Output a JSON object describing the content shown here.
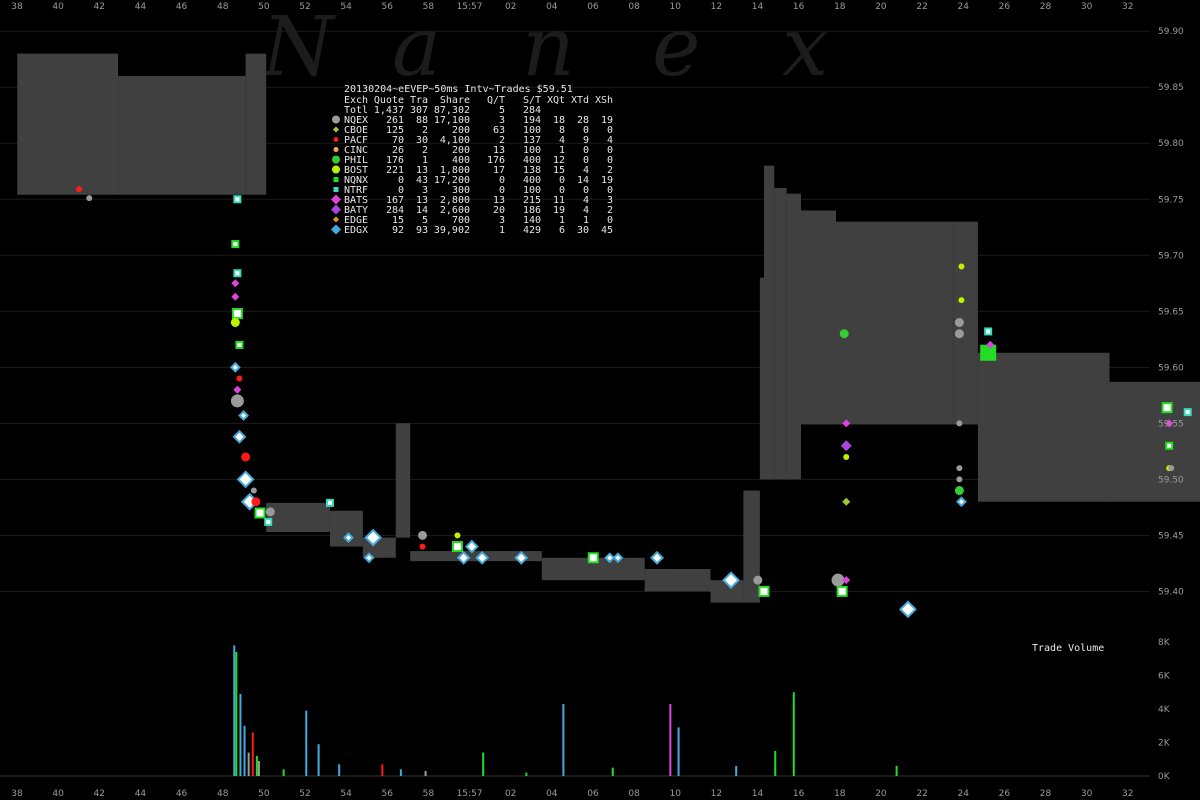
{
  "watermark": [
    "N",
    "a",
    "n",
    "e",
    "x"
  ],
  "colors": {
    "background": "#000000",
    "nbbo_band": "#404040",
    "gridline": "#1b1b1b",
    "cursor": "#666666",
    "NQEX": "#9a9a9a",
    "CBOE": "#9acd32",
    "PACF": "#ff1a1a",
    "CINC": "#ffa64d",
    "PHIL": "#33cc33",
    "BOST": "#bff000",
    "NQNX": "#22dd22",
    "NTRF": "#33ddbb",
    "BATS": "#dd44dd",
    "BATY": "#aa44dd",
    "EDGE": "#dd9911",
    "EDGX": "#44aadd"
  },
  "chart_data": {
    "type": "scatter",
    "title": "20130204~eEVEP~50ms Intv~Trades $59.51",
    "x_ticks_top": [
      "38",
      "40",
      "42",
      "44",
      "46",
      "48",
      "50",
      "52",
      "54",
      "56",
      "58",
      "15:57",
      "02",
      "04",
      "06",
      "08",
      "10",
      "12",
      "14",
      "16",
      "18",
      "20",
      "22",
      "24",
      "26",
      "28",
      "30",
      "32"
    ],
    "x_ticks_bottom": [
      "38",
      "40",
      "42",
      "44",
      "46",
      "48",
      "50",
      "52",
      "54",
      "56",
      "58",
      "15:57",
      "02",
      "04",
      "06",
      "08",
      "10",
      "12",
      "14",
      "16",
      "18",
      "20",
      "22",
      "24",
      "26",
      "28",
      "30",
      "32"
    ],
    "xlim": [
      37,
      133
    ],
    "cursor_x": 96,
    "ylim": [
      59.37,
      59.91
    ],
    "y_ticks": [
      "59.90",
      "59.85",
      "59.80",
      "59.75",
      "59.70",
      "59.65",
      "59.60",
      "59.55",
      "59.50",
      "59.45",
      "59.40"
    ],
    "volume_label": "Trade Volume",
    "volume_ylim": [
      0,
      8000
    ],
    "volume_ticks": [
      "8K",
      "6K",
      "4K",
      "2K",
      "0K"
    ],
    "legend": {
      "columns": [
        "Exch",
        "Quote",
        "Tra",
        "Share",
        "Q/T",
        "S/T",
        "XQt",
        "XTd",
        "XSh"
      ],
      "total_row": [
        "Totl",
        "1,437",
        "307",
        "87,302",
        "5",
        "284",
        "",
        "",
        ""
      ],
      "rows": [
        {
          "exch": "NQEX",
          "quote": "261",
          "tra": "88",
          "share": "17,100",
          "qt": "3",
          "st": "194",
          "xqt": "18",
          "xtd": "28",
          "xsh": "19",
          "marker": "circle"
        },
        {
          "exch": "CBOE",
          "quote": "125",
          "tra": "2",
          "share": "200",
          "qt": "63",
          "st": "100",
          "xqt": "8",
          "xtd": "0",
          "xsh": "0",
          "marker": "diamond"
        },
        {
          "exch": "PACF",
          "quote": "70",
          "tra": "30",
          "share": "4,100",
          "qt": "2",
          "st": "137",
          "xqt": "4",
          "xtd": "9",
          "xsh": "4",
          "marker": "circle"
        },
        {
          "exch": "CINC",
          "quote": "26",
          "tra": "2",
          "share": "200",
          "qt": "13",
          "st": "100",
          "xqt": "1",
          "xtd": "0",
          "xsh": "0",
          "marker": "circle"
        },
        {
          "exch": "PHIL",
          "quote": "176",
          "tra": "1",
          "share": "400",
          "qt": "176",
          "st": "400",
          "xqt": "12",
          "xtd": "0",
          "xsh": "0",
          "marker": "circle"
        },
        {
          "exch": "BOST",
          "quote": "221",
          "tra": "13",
          "share": "1,800",
          "qt": "17",
          "st": "138",
          "xqt": "15",
          "xtd": "4",
          "xsh": "2",
          "marker": "circle"
        },
        {
          "exch": "NQNX",
          "quote": "0",
          "tra": "43",
          "share": "17,200",
          "qt": "0",
          "st": "400",
          "xqt": "0",
          "xtd": "14",
          "xsh": "19",
          "marker": "square"
        },
        {
          "exch": "NTRF",
          "quote": "0",
          "tra": "3",
          "share": "300",
          "qt": "0",
          "st": "100",
          "xqt": "0",
          "xtd": "0",
          "xsh": "0",
          "marker": "square"
        },
        {
          "exch": "BATS",
          "quote": "167",
          "tra": "13",
          "share": "2,800",
          "qt": "13",
          "st": "215",
          "xqt": "11",
          "xtd": "4",
          "xsh": "3",
          "marker": "diamond"
        },
        {
          "exch": "BATY",
          "quote": "284",
          "tra": "14",
          "share": "2,600",
          "qt": "20",
          "st": "186",
          "xqt": "19",
          "xtd": "4",
          "xsh": "2",
          "marker": "diamond"
        },
        {
          "exch": "EDGE",
          "quote": "15",
          "tra": "5",
          "share": "700",
          "qt": "3",
          "st": "140",
          "xqt": "1",
          "xtd": "1",
          "xsh": "0",
          "marker": "diamond"
        },
        {
          "exch": "EDGX",
          "quote": "92",
          "tra": "93",
          "share": "39,902",
          "qt": "1",
          "st": "429",
          "xqt": "6",
          "xtd": "30",
          "xsh": "45",
          "marker": "diamond"
        }
      ]
    },
    "nbbo_band": [
      {
        "x0": 37.5,
        "x1": 42.4,
        "lo": 59.754,
        "hi": 59.88
      },
      {
        "x0": 42.4,
        "x1": 48.6,
        "lo": 59.754,
        "hi": 59.86
      },
      {
        "x0": 48.6,
        "x1": 49.6,
        "lo": 59.754,
        "hi": 59.88
      },
      {
        "x0": 49.6,
        "x1": 52.7,
        "lo": 59.453,
        "hi": 59.479
      },
      {
        "x0": 52.7,
        "x1": 54.3,
        "lo": 59.44,
        "hi": 59.472
      },
      {
        "x0": 54.3,
        "x1": 55.9,
        "lo": 59.43,
        "hi": 59.448
      },
      {
        "x0": 55.9,
        "x1": 56.6,
        "lo": 59.448,
        "hi": 59.55
      },
      {
        "x0": 56.6,
        "x1": 63.0,
        "lo": 59.427,
        "hi": 59.436
      },
      {
        "x0": 63.0,
        "x1": 68.0,
        "lo": 59.41,
        "hi": 59.43
      },
      {
        "x0": 68.0,
        "x1": 71.2,
        "lo": 59.4,
        "hi": 59.42
      },
      {
        "x0": 71.2,
        "x1": 72.8,
        "lo": 59.39,
        "hi": 59.41
      },
      {
        "x0": 72.8,
        "x1": 73.6,
        "lo": 59.39,
        "hi": 59.49
      },
      {
        "x0": 73.6,
        "x1": 73.8,
        "lo": 59.5,
        "hi": 59.68
      },
      {
        "x0": 73.8,
        "x1": 74.3,
        "lo": 59.5,
        "hi": 59.78
      },
      {
        "x0": 74.3,
        "x1": 74.9,
        "lo": 59.5,
        "hi": 59.76
      },
      {
        "x0": 74.9,
        "x1": 75.6,
        "lo": 59.5,
        "hi": 59.755
      },
      {
        "x0": 75.6,
        "x1": 77.3,
        "lo": 59.549,
        "hi": 59.74
      },
      {
        "x0": 77.3,
        "x1": 83.0,
        "lo": 59.549,
        "hi": 59.73
      },
      {
        "x0": 83.0,
        "x1": 84.2,
        "lo": 59.549,
        "hi": 59.73
      },
      {
        "x0": 84.2,
        "x1": 90.6,
        "lo": 59.48,
        "hi": 59.613
      },
      {
        "x0": 90.6,
        "x1": 96.5,
        "lo": 59.48,
        "hi": 59.587
      },
      {
        "x0": 96.5,
        "x1": 96.7,
        "lo": 59.48,
        "hi": 59.6
      },
      {
        "x0": 96.7,
        "x1": 99.2,
        "lo": 59.48,
        "hi": 59.66
      },
      {
        "x0": 99.2,
        "x1": 100.9,
        "lo": 59.5,
        "hi": 59.66
      },
      {
        "x0": 100.9,
        "x1": 103.0,
        "lo": 59.55,
        "hi": 59.66
      },
      {
        "x0": 103.0,
        "x1": 105.7,
        "lo": 59.56,
        "hi": 59.66
      }
    ],
    "trades": [
      {
        "t": 40.5,
        "p": 59.759,
        "ex": "PACF",
        "sz": "s"
      },
      {
        "t": 41,
        "p": 59.751,
        "ex": "NQEX",
        "sz": "s"
      },
      {
        "t": 48.2,
        "p": 59.75,
        "ex": "NTRF",
        "sz": "s"
      },
      {
        "t": 48.1,
        "p": 59.71,
        "ex": "NQNX",
        "sz": "s"
      },
      {
        "t": 48.2,
        "p": 59.684,
        "ex": "NTRF",
        "sz": "s"
      },
      {
        "t": 48.1,
        "p": 59.675,
        "ex": "BATS",
        "sz": "s"
      },
      {
        "t": 48.1,
        "p": 59.663,
        "ex": "BATS",
        "sz": "s"
      },
      {
        "t": 48.2,
        "p": 59.648,
        "ex": "NQNX",
        "sz": "m"
      },
      {
        "t": 48.1,
        "p": 59.64,
        "ex": "BOST",
        "sz": "m"
      },
      {
        "t": 48.3,
        "p": 59.62,
        "ex": "NQNX",
        "sz": "s"
      },
      {
        "t": 48.1,
        "p": 59.6,
        "ex": "EDGX",
        "sz": "s"
      },
      {
        "t": 48.3,
        "p": 59.59,
        "ex": "PACF",
        "sz": "s"
      },
      {
        "t": 48.2,
        "p": 59.58,
        "ex": "BATS",
        "sz": "s"
      },
      {
        "t": 48.2,
        "p": 59.57,
        "ex": "NQEX",
        "sz": "l"
      },
      {
        "t": 48.5,
        "p": 59.557,
        "ex": "EDGX",
        "sz": "s"
      },
      {
        "t": 48.3,
        "p": 59.538,
        "ex": "EDGX",
        "sz": "m"
      },
      {
        "t": 48.6,
        "p": 59.52,
        "ex": "PACF",
        "sz": "m"
      },
      {
        "t": 48.6,
        "p": 59.5,
        "ex": "EDGX",
        "sz": "l"
      },
      {
        "t": 49.0,
        "p": 59.49,
        "ex": "NQEX",
        "sz": "s"
      },
      {
        "t": 48.8,
        "p": 59.48,
        "ex": "EDGX",
        "sz": "l"
      },
      {
        "t": 49.1,
        "p": 59.48,
        "ex": "PACF",
        "sz": "m"
      },
      {
        "t": 49.3,
        "p": 59.47,
        "ex": "NQNX",
        "sz": "m"
      },
      {
        "t": 49.8,
        "p": 59.471,
        "ex": "NQEX",
        "sz": "m"
      },
      {
        "t": 49.7,
        "p": 59.462,
        "ex": "NTRF",
        "sz": "s"
      },
      {
        "t": 52.7,
        "p": 59.479,
        "ex": "NTRF",
        "sz": "s"
      },
      {
        "t": 53.6,
        "p": 59.448,
        "ex": "EDGX",
        "sz": "s"
      },
      {
        "t": 54.8,
        "p": 59.448,
        "ex": "EDGX",
        "sz": "l"
      },
      {
        "t": 54.6,
        "p": 59.43,
        "ex": "EDGX",
        "sz": "s"
      },
      {
        "t": 57.2,
        "p": 59.45,
        "ex": "NQEX",
        "sz": "m"
      },
      {
        "t": 57.2,
        "p": 59.44,
        "ex": "PACF",
        "sz": "s"
      },
      {
        "t": 58.9,
        "p": 59.45,
        "ex": "BOST",
        "sz": "s"
      },
      {
        "t": 58.9,
        "p": 59.44,
        "ex": "NQNX",
        "sz": "m"
      },
      {
        "t": 59.2,
        "p": 59.43,
        "ex": "EDGX",
        "sz": "m"
      },
      {
        "t": 59.6,
        "p": 59.44,
        "ex": "EDGX",
        "sz": "m"
      },
      {
        "t": 60.1,
        "p": 59.43,
        "ex": "EDGX",
        "sz": "m"
      },
      {
        "t": 62.0,
        "p": 59.43,
        "ex": "EDGX",
        "sz": "m"
      },
      {
        "t": 65.5,
        "p": 59.43,
        "ex": "NQNX",
        "sz": "m"
      },
      {
        "t": 66.3,
        "p": 59.43,
        "ex": "EDGX",
        "sz": "s"
      },
      {
        "t": 66.7,
        "p": 59.43,
        "ex": "EDGX",
        "sz": "s"
      },
      {
        "t": 68.6,
        "p": 59.43,
        "ex": "EDGX",
        "sz": "m"
      },
      {
        "t": 72.2,
        "p": 59.41,
        "ex": "EDGX",
        "sz": "l"
      },
      {
        "t": 73.5,
        "p": 59.41,
        "ex": "NQEX",
        "sz": "m"
      },
      {
        "t": 73.8,
        "p": 59.4,
        "ex": "NQNX",
        "sz": "m"
      },
      {
        "t": 77.4,
        "p": 59.41,
        "ex": "NQEX",
        "sz": "l"
      },
      {
        "t": 77.6,
        "p": 59.4,
        "ex": "NQNX",
        "sz": "m"
      },
      {
        "t": 77.8,
        "p": 59.41,
        "ex": "BATS",
        "sz": "s"
      },
      {
        "t": 77.7,
        "p": 59.63,
        "ex": "PHIL",
        "sz": "m"
      },
      {
        "t": 77.8,
        "p": 59.55,
        "ex": "BATS",
        "sz": "s"
      },
      {
        "t": 77.8,
        "p": 59.53,
        "ex": "BATY",
        "sz": "m"
      },
      {
        "t": 77.8,
        "p": 59.52,
        "ex": "BOST",
        "sz": "s"
      },
      {
        "t": 77.8,
        "p": 59.48,
        "ex": "CBOE",
        "sz": "s"
      },
      {
        "t": 80.8,
        "p": 59.384,
        "ex": "EDGX",
        "sz": "l"
      },
      {
        "t": 83.4,
        "p": 59.69,
        "ex": "BOST",
        "sz": "s"
      },
      {
        "t": 83.4,
        "p": 59.66,
        "ex": "BOST",
        "sz": "s"
      },
      {
        "t": 83.3,
        "p": 59.64,
        "ex": "NQEX",
        "sz": "m"
      },
      {
        "t": 83.3,
        "p": 59.63,
        "ex": "NQEX",
        "sz": "m"
      },
      {
        "t": 83.3,
        "p": 59.55,
        "ex": "NQEX",
        "sz": "s"
      },
      {
        "t": 83.3,
        "p": 59.51,
        "ex": "NQEX",
        "sz": "s"
      },
      {
        "t": 83.3,
        "p": 59.5,
        "ex": "NQEX",
        "sz": "s"
      },
      {
        "t": 83.3,
        "p": 59.49,
        "ex": "PHIL",
        "sz": "m"
      },
      {
        "t": 83.4,
        "p": 59.48,
        "ex": "EDGX",
        "sz": "s"
      },
      {
        "t": 84.7,
        "p": 59.613,
        "ex": "NQNX",
        "sz": "xl"
      },
      {
        "t": 84.7,
        "p": 59.632,
        "ex": "NTRF",
        "sz": "s"
      },
      {
        "t": 84.8,
        "p": 59.62,
        "ex": "BATS",
        "sz": "s"
      },
      {
        "t": 93.4,
        "p": 59.564,
        "ex": "NQNX",
        "sz": "m"
      },
      {
        "t": 94.4,
        "p": 59.56,
        "ex": "NTRF",
        "sz": "s"
      },
      {
        "t": 93.5,
        "p": 59.55,
        "ex": "BATS",
        "sz": "s"
      },
      {
        "t": 93.5,
        "p": 59.53,
        "ex": "NQNX",
        "sz": "s"
      },
      {
        "t": 93.5,
        "p": 59.51,
        "ex": "BOST",
        "sz": "s"
      },
      {
        "t": 93.6,
        "p": 59.51,
        "ex": "NQEX",
        "sz": "s"
      },
      {
        "t": 100.2,
        "p": 59.632,
        "ex": "PACF",
        "sz": "m"
      },
      {
        "t": 100.0,
        "p": 59.6,
        "ex": "NQNX",
        "sz": "xl"
      },
      {
        "t": 100.2,
        "p": 59.585,
        "ex": "NTRF",
        "sz": "s"
      },
      {
        "t": 100.2,
        "p": 59.57,
        "ex": "NTRF",
        "sz": "s"
      },
      {
        "t": 100.2,
        "p": 59.53,
        "ex": "PACF",
        "sz": "m"
      },
      {
        "t": 102.5,
        "p": 59.57,
        "ex": "NTRF",
        "sz": "s"
      },
      {
        "t": 102.4,
        "p": 59.48,
        "ex": "NQNX",
        "sz": "m"
      },
      {
        "t": 102.9,
        "p": 59.65,
        "ex": "NQNX",
        "sz": "l"
      },
      {
        "t": 102.8,
        "p": 59.64,
        "ex": "BOST",
        "sz": "m"
      },
      {
        "t": 102.8,
        "p": 59.63,
        "ex": "BATY",
        "sz": "s"
      }
    ],
    "volume_bars": [
      {
        "t": 48.0,
        "v": 7800,
        "ex": "EDGX"
      },
      {
        "t": 48.1,
        "v": 7400,
        "ex": "NQNX"
      },
      {
        "t": 48.3,
        "v": 4900,
        "ex": "EDGX"
      },
      {
        "t": 48.5,
        "v": 3000,
        "ex": "EDGX"
      },
      {
        "t": 48.7,
        "v": 1400,
        "ex": "NQEX"
      },
      {
        "t": 48.9,
        "v": 2600,
        "ex": "PACF"
      },
      {
        "t": 49.1,
        "v": 1200,
        "ex": "NQNX"
      },
      {
        "t": 49.2,
        "v": 900,
        "ex": "NQEX"
      },
      {
        "t": 50.4,
        "v": 400,
        "ex": "NQNX"
      },
      {
        "t": 51.5,
        "v": 3900,
        "ex": "EDGX"
      },
      {
        "t": 52.1,
        "v": 1900,
        "ex": "EDGX"
      },
      {
        "t": 53.1,
        "v": 700,
        "ex": "EDGX"
      },
      {
        "t": 55.2,
        "v": 700,
        "ex": "PACF"
      },
      {
        "t": 56.1,
        "v": 400,
        "ex": "EDGX"
      },
      {
        "t": 57.3,
        "v": 300,
        "ex": "NQEX"
      },
      {
        "t": 60.1,
        "v": 1400,
        "ex": "NQNX"
      },
      {
        "t": 62.2,
        "v": 200,
        "ex": "NQNX"
      },
      {
        "t": 64.0,
        "v": 4300,
        "ex": "EDGX"
      },
      {
        "t": 66.4,
        "v": 500,
        "ex": "NQNX"
      },
      {
        "t": 69.2,
        "v": 4300,
        "ex": "BATS"
      },
      {
        "t": 69.6,
        "v": 2900,
        "ex": "EDGX"
      },
      {
        "t": 72.4,
        "v": 600,
        "ex": "EDGX"
      },
      {
        "t": 74.3,
        "v": 1500,
        "ex": "NQNX"
      },
      {
        "t": 75.2,
        "v": 5000,
        "ex": "NQNX"
      },
      {
        "t": 80.2,
        "v": 600,
        "ex": "NQNX"
      },
      {
        "t": 96.7,
        "v": 6900,
        "ex": "BATS"
      },
      {
        "t": 96.8,
        "v": 4200,
        "ex": "NQNX"
      },
      {
        "t": 102.8,
        "v": 900,
        "ex": "NQNX"
      }
    ]
  }
}
